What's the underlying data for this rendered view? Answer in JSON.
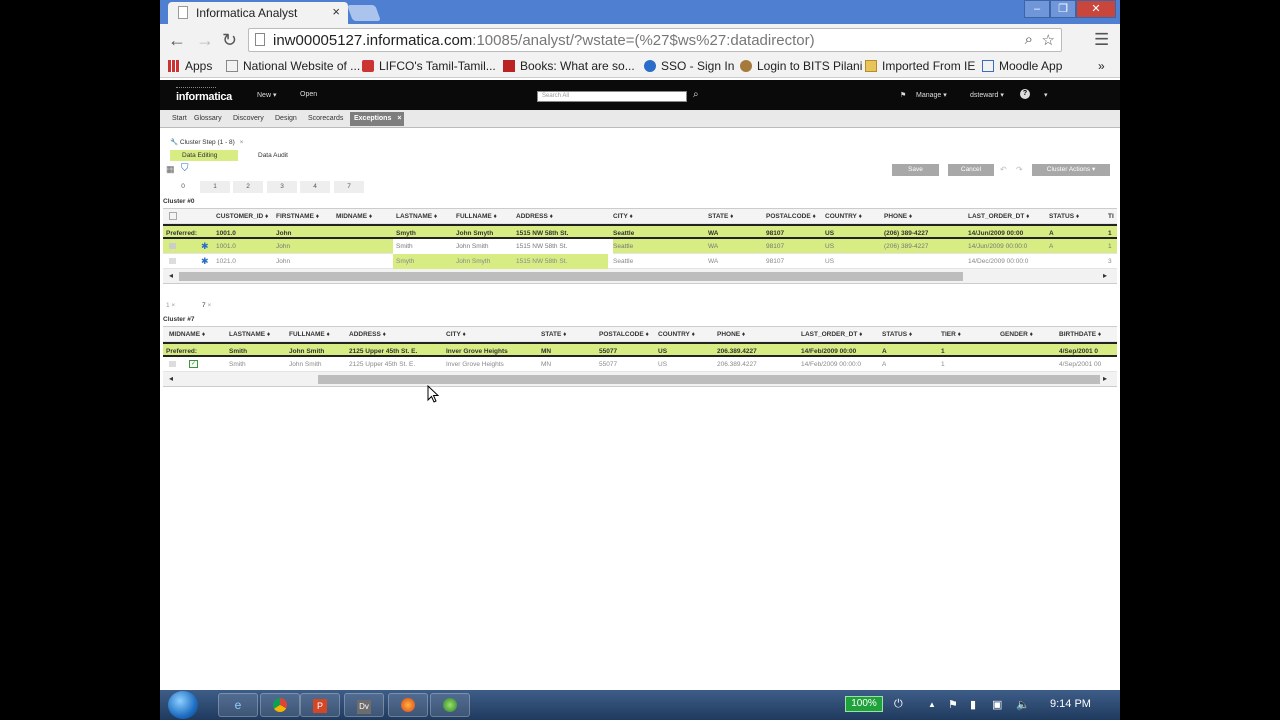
{
  "browser": {
    "tab_title": "Informatica Analyst",
    "tab_close": "×",
    "window_buttons": [
      "–",
      "❐",
      "✕"
    ],
    "url_host": "inw00005127.informatica.com",
    "url_rest": ":10085/analyst/?wstate=(%27$ws%27:datadirector)",
    "bookmarks": [
      "Apps",
      "National Website of ...",
      "LIFCO's Tamil-Tamil...",
      "Books: What are so...",
      "SSO - Sign In",
      "Login to BITS Pilani",
      "Imported From IE",
      "Moodle App"
    ],
    "bookmark_more": "»"
  },
  "app": {
    "logo": "informatica",
    "menu_new": "New",
    "menu_open": "Open",
    "search_placeholder": "Search All",
    "manage": "Manage",
    "user": "dsteward",
    "help": "?",
    "tabs": [
      "Start",
      "Glossary",
      "Discovery",
      "Design",
      "Scorecards"
    ],
    "active_tab": "Exceptions",
    "active_tab_close": "×"
  },
  "workspace": {
    "cluster_step_tab": "Cluster Step (1 - 8)",
    "data_editing": "Data Editing",
    "data_audit": "Data Audit",
    "save": "Save",
    "cancel": "Cancel",
    "cluster_actions": "Cluster Actions",
    "number_tabs": [
      "0",
      "1",
      "2",
      "3",
      "4",
      "7"
    ]
  },
  "cluster0": {
    "title": "Cluster #0",
    "headers": [
      "CUSTOMER_ID ♦",
      "FIRSTNAME ♦",
      "MIDNAME ♦",
      "LASTNAME ♦",
      "FULLNAME ♦",
      "ADDRESS ♦",
      "CITY ♦",
      "STATE ♦",
      "POSTALCODE ♦",
      "COUNTRY ♦",
      "PHONE ♦",
      "LAST_ORDER_DT ♦",
      "STATUS ♦",
      "TI"
    ],
    "preferred_label": "Preferred:",
    "preferred": [
      "1001.0",
      "John",
      "",
      "Smyth",
      "John Smyth",
      "1515 NW 58th St.",
      "Seattle",
      "WA",
      "98107",
      "US",
      "(206) 389-4227",
      "14/Jun/2009 00:00",
      "A",
      "1"
    ],
    "rows": [
      [
        "1001.0",
        "John",
        "",
        "Smith",
        "John Smith",
        "1515 NW 58th St.",
        "Seattle",
        "WA",
        "98107",
        "US",
        "(206) 389-4227",
        "14/Jun/2009 00:00:0",
        "A",
        "1"
      ],
      [
        "1021.0",
        "John",
        "",
        "Smyth",
        "John Smyth",
        "1515 NW 58th St.",
        "Seattle",
        "WA",
        "98107",
        "US",
        "",
        "14/Dec/2009 00:00:0",
        "",
        "3"
      ]
    ]
  },
  "cluster7": {
    "tab_labels": [
      "1",
      "7"
    ],
    "title": "Cluster #7",
    "headers": [
      "MIDNAME ♦",
      "LASTNAME ♦",
      "FULLNAME ♦",
      "ADDRESS ♦",
      "CITY ♦",
      "STATE ♦",
      "POSTALCODE ♦",
      "COUNTRY ♦",
      "PHONE ♦",
      "LAST_ORDER_DT ♦",
      "STATUS ♦",
      "TIER ♦",
      "GENDER ♦",
      "BIRTHDATE ♦"
    ],
    "preferred_label": "Preferred:",
    "preferred": [
      "Smith",
      "John Smith",
      "2125 Upper 45th St. E.",
      "Inver Grove Heights",
      "MN",
      "55077",
      "US",
      "206.389.4227",
      "14/Feb/2009 00:00",
      "A",
      "1",
      "",
      "4/Sep/2001 0"
    ],
    "rows": [
      [
        "Smith",
        "John Smith",
        "2125 Upper 45th St. E.",
        "Inver Grove Heights",
        "MN",
        "55077",
        "US",
        "206.389.4227",
        "14/Feb/2009 00:00:0",
        "A",
        "1",
        "",
        "4/Sep/2001 00"
      ]
    ]
  },
  "taskbar": {
    "battery": "100%",
    "clock": "9:14 PM"
  }
}
